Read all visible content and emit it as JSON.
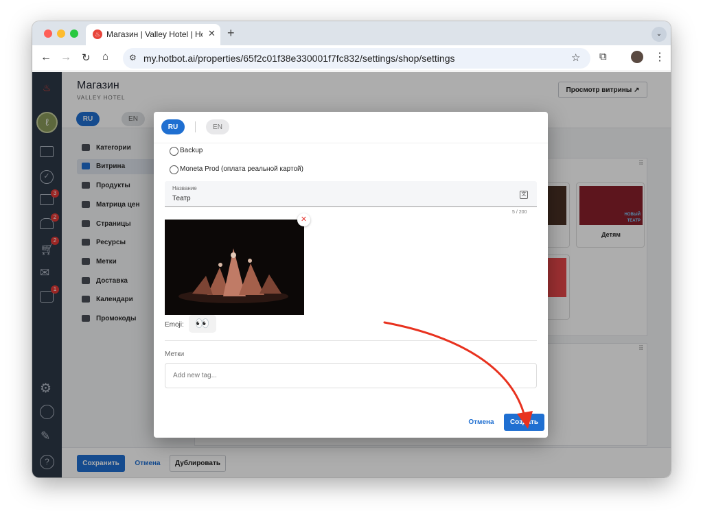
{
  "browser": {
    "tab_title": "Магазин | Valley Hotel | Hotb",
    "url": "my.hotbot.ai/properties/65f2c01f38e330001f7fc832/settings/shop/settings"
  },
  "page": {
    "title": "Магазин",
    "subtitle": "VALLEY HOTEL",
    "preview_button": "Просмотр витрины ↗",
    "lang_ru": "RU",
    "lang_en": "EN"
  },
  "rail": {
    "badges": [
      "3",
      "2",
      "2",
      "1"
    ]
  },
  "sidebar": {
    "items": [
      {
        "label": "Категории"
      },
      {
        "label": "Витрина"
      },
      {
        "label": "Продукты"
      },
      {
        "label": "Матрица цен"
      },
      {
        "label": "Страницы"
      },
      {
        "label": "Ресурсы"
      },
      {
        "label": "Метки"
      },
      {
        "label": "Доставка"
      },
      {
        "label": "Календари"
      },
      {
        "label": "Промокоды"
      }
    ]
  },
  "cards": {
    "kids": "Детям",
    "kids_badge_1": "НОВЫЙ",
    "kids_badge_2": "ТЕАТР",
    "card_partial": "арта"
  },
  "footer": {
    "save": "Сохранить",
    "cancel": "Отмена",
    "duplicate": "Дублировать"
  },
  "modal": {
    "lang_ru": "RU",
    "lang_en": "EN",
    "options": [
      {
        "label": "Backup"
      },
      {
        "label": "Moneta Prod (оплата реальной картой)"
      }
    ],
    "name_label": "Название",
    "name_value": "Театр",
    "counter": "5 / 200",
    "emoji_label": "Emoji:",
    "emoji_value": "👀",
    "tags_label": "Метки",
    "tags_placeholder": "Add new tag...",
    "cancel": "Отмена",
    "create": "Создать"
  },
  "colors": {
    "primary": "#1f6fd1",
    "rail": "#2d3848",
    "arrow": "#e8321f"
  }
}
